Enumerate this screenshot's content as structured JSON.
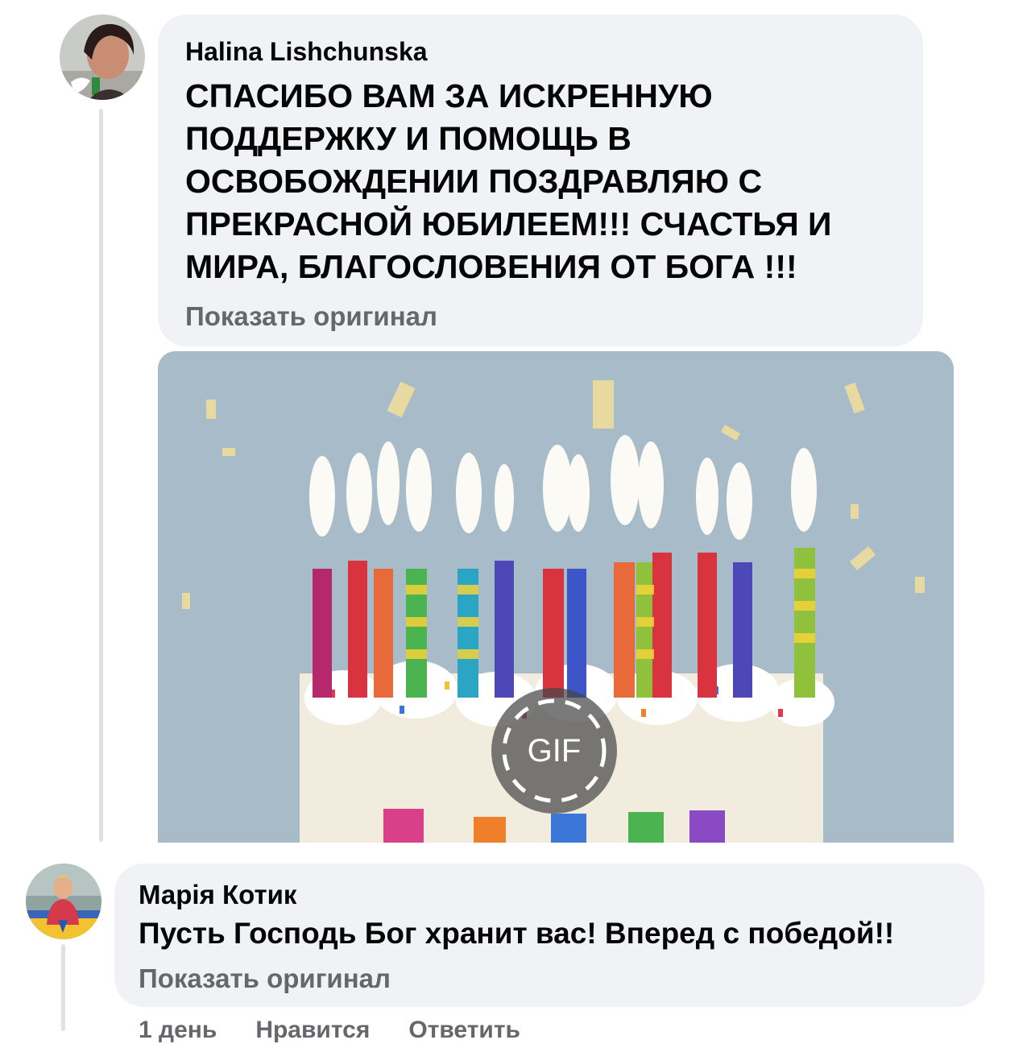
{
  "comments": [
    {
      "author": "Halina Lishchunska",
      "lines": [
        "СПАСИБО ВАМ ЗА ИСКРЕННУЮ",
        "ПОДДЕРЖКУ И ПОМОЩЬ В",
        "ОСВОБОЖДЕНИИ ПОЗДРАВЛЯЮ С",
        "ПРЕКРАСНОЙ ЮБИЛЕЕМ!!! СЧАСТЬЯ И",
        "МИРА, БЛАГОСЛОВЕНИЯ ОТ БОГА !!!"
      ],
      "show_original": "Показать оригинал",
      "attachment": {
        "badge_label": "GIF"
      }
    },
    {
      "author": "Марія Котик",
      "text": "Пусть Господь Бог хранит вас! Вперед с победой!!",
      "show_original": "Показать оригинал",
      "actions": {
        "time": "1 день",
        "like": "Нравится",
        "reply": "Ответить"
      }
    }
  ],
  "colors": {
    "bubble": "#f0f2f5",
    "text": "#050505",
    "secondary_text": "#65676b",
    "gif_background": "#a7bbc8"
  },
  "icons": [
    "user-avatar-photo",
    "gif-play-badge"
  ]
}
